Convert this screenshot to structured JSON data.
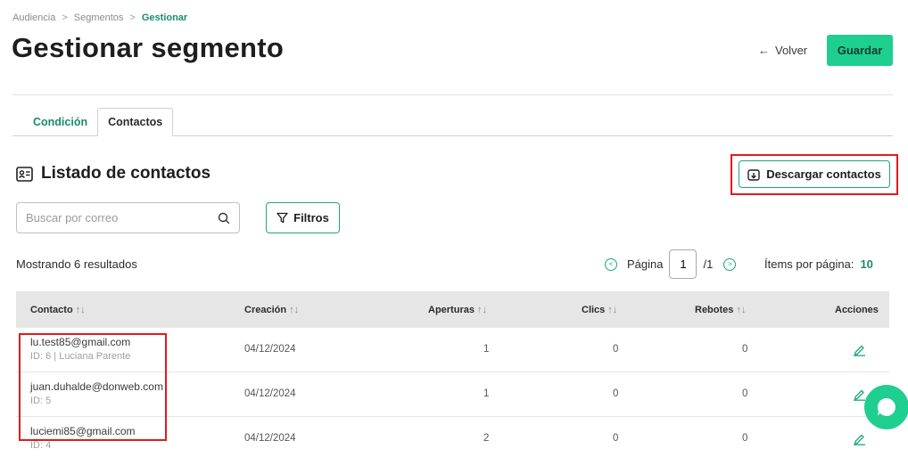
{
  "breadcrumb": {
    "items": [
      "Audiencia",
      "Segmentos"
    ],
    "current": "Gestionar"
  },
  "page": {
    "title": "Gestionar segmento"
  },
  "header": {
    "back_label": "Volver",
    "save_label": "Guardar"
  },
  "tabs": [
    {
      "label": "Condición"
    },
    {
      "label": "Contactos"
    }
  ],
  "section": {
    "title": "Listado de contactos",
    "download_label": "Descargar contactos"
  },
  "search": {
    "placeholder": "Buscar por correo"
  },
  "filters": {
    "label": "Filtros"
  },
  "results": {
    "text": "Mostrando 6 resultados"
  },
  "pagination": {
    "label": "Página",
    "current": "1",
    "total": "/1",
    "items_label": "Ítems por página:",
    "items_value": "10"
  },
  "table": {
    "headers": {
      "contact": "Contacto",
      "created": "Creación",
      "opens": "Aperturas",
      "clicks": "Clics",
      "bounces": "Rebotes",
      "actions": "Acciones"
    },
    "rows": [
      {
        "email": "lu.test85@gmail.com",
        "sub": "ID: 6 | Luciana Parente",
        "created": "04/12/2024",
        "opens": "1",
        "clicks": "0",
        "bounces": "0"
      },
      {
        "email": "juan.duhalde@donweb.com",
        "sub": "ID: 5",
        "created": "04/12/2024",
        "opens": "1",
        "clicks": "0",
        "bounces": "0"
      },
      {
        "email": "luciemi85@gmail.com",
        "sub": "ID: 4",
        "created": "04/12/2024",
        "opens": "2",
        "clicks": "0",
        "bounces": "0"
      }
    ]
  },
  "colors": {
    "accent": "#1fcf8f",
    "accent_dark": "#1a8b6e",
    "highlight": "#e01b1b",
    "header_bg": "#e6e6e6"
  },
  "icons": [
    "arrow-left-icon",
    "contact-card-icon",
    "download-icon",
    "search-icon",
    "filter-icon",
    "chevron-left-icon",
    "chevron-right-icon",
    "sort-icon",
    "edit-icon",
    "chat-icon"
  ]
}
